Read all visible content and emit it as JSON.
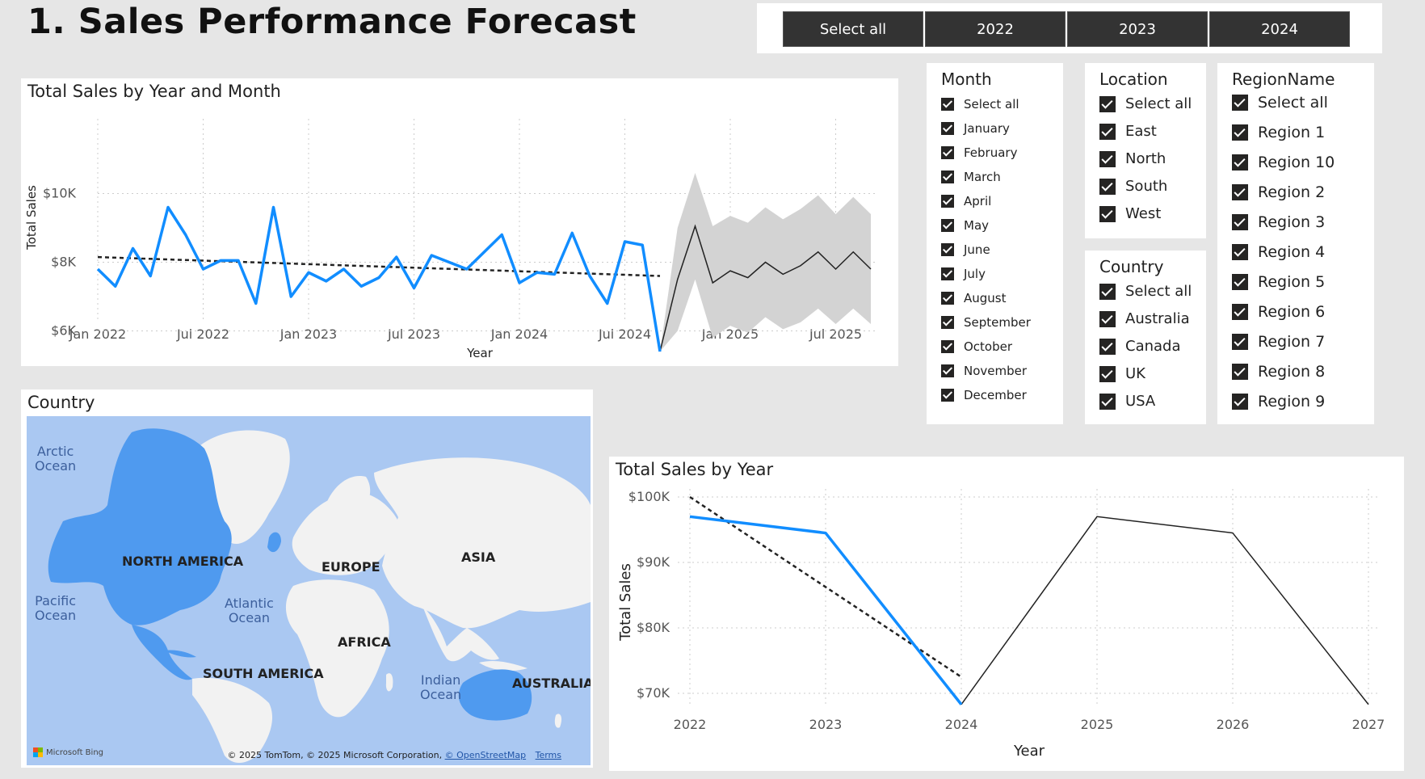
{
  "header": {
    "title": "1. Sales Performance Forecast"
  },
  "year_slicer": {
    "buttons": [
      "Select all",
      "2022",
      "2023",
      "2024"
    ]
  },
  "month_slicer": {
    "title": "Month",
    "items": [
      "Select all",
      "January",
      "February",
      "March",
      "April",
      "May",
      "June",
      "July",
      "August",
      "September",
      "October",
      "November",
      "December"
    ]
  },
  "location_slicer": {
    "title": "Location",
    "items": [
      "Select all",
      "East",
      "North",
      "South",
      "West"
    ]
  },
  "country_slicer": {
    "title": "Country",
    "items": [
      "Select all",
      "Australia",
      "Canada",
      "UK",
      "USA"
    ]
  },
  "region_slicer": {
    "title": "RegionName",
    "items": [
      "Select all",
      "Region 1",
      "Region 10",
      "Region 2",
      "Region 3",
      "Region 4",
      "Region 5",
      "Region 6",
      "Region 7",
      "Region 8",
      "Region 9"
    ]
  },
  "map": {
    "title": "Country",
    "continents": [
      "NORTH AMERICA",
      "EUROPE",
      "ASIA",
      "AFRICA",
      "SOUTH AMERICA",
      "AUSTRALIA"
    ],
    "oceans": [
      "Arctic\nOcean",
      "Pacific\nOcean",
      "Atlantic\nOcean",
      "Indian\nOcean"
    ],
    "bing_label": "Microsoft Bing",
    "credit_text": "© 2025 TomTom, © 2025 Microsoft Corporation, ",
    "credit_link": "© OpenStreetMap",
    "terms_link": "Terms"
  },
  "chart_data": [
    {
      "type": "line",
      "title": "Total Sales by Year and Month",
      "xlabel": "Year",
      "ylabel": "Total Sales",
      "x_ticks": [
        "Jan 2022",
        "Jul 2022",
        "Jan 2023",
        "Jul 2023",
        "Jan 2024",
        "Jul 2024",
        "Jan 2025",
        "Jul 2025"
      ],
      "y_ticks": [
        "$6K",
        "$8K",
        "$10K"
      ],
      "ylim": [
        5000,
        11000
      ],
      "grid": true,
      "series": [
        {
          "kind": "actual",
          "start": "Jan 2022",
          "values": [
            7800,
            7300,
            8400,
            7600,
            9600,
            8800,
            7800,
            8050,
            8050,
            6800,
            9600,
            7000,
            7700,
            7450,
            7800,
            7300,
            7550,
            8150,
            7250,
            8200,
            8000,
            7800,
            8300,
            8800,
            7400,
            7700,
            7650,
            8850,
            7600,
            6800,
            8600,
            8500,
            5400
          ],
          "color": "#118dff"
        },
        {
          "kind": "trend",
          "start_value": 8150,
          "end_value": 7600,
          "color": "#222222"
        },
        {
          "kind": "forecast",
          "start": "Sep 2024",
          "values": [
            5400,
            7500,
            9050,
            7400,
            7750,
            7550,
            8000,
            7650,
            7900,
            8300,
            7800,
            8300,
            7800
          ],
          "upper": [
            5400,
            9000,
            10600,
            9050,
            9350,
            9150,
            9600,
            9250,
            9550,
            9950,
            9400,
            9900,
            9400
          ],
          "lower": [
            5400,
            6000,
            7500,
            5800,
            6150,
            5950,
            6400,
            6050,
            6250,
            6650,
            6200,
            6650,
            6200
          ],
          "color": "#222222",
          "band_color": "#d3d3d3"
        }
      ]
    },
    {
      "type": "line",
      "title": "Total Sales by Year",
      "xlabel": "Year",
      "ylabel": "Total Sales",
      "x_ticks": [
        "2022",
        "2023",
        "2024",
        "2025",
        "2026",
        "2027"
      ],
      "y_ticks": [
        "$70K",
        "$80K",
        "$90K",
        "$100K"
      ],
      "ylim": [
        68000,
        100000
      ],
      "grid": true,
      "series": [
        {
          "kind": "actual",
          "x": [
            2022,
            2023,
            2024
          ],
          "values": [
            97000,
            94500,
            68300
          ],
          "color": "#118dff"
        },
        {
          "kind": "trend",
          "x": [
            2022,
            2024
          ],
          "values": [
            100000,
            72500
          ],
          "color": "#222222"
        },
        {
          "kind": "forecast",
          "x": [
            2024,
            2025,
            2026,
            2027
          ],
          "values": [
            68300,
            97000,
            94500,
            68300
          ],
          "color": "#222222"
        }
      ]
    }
  ]
}
